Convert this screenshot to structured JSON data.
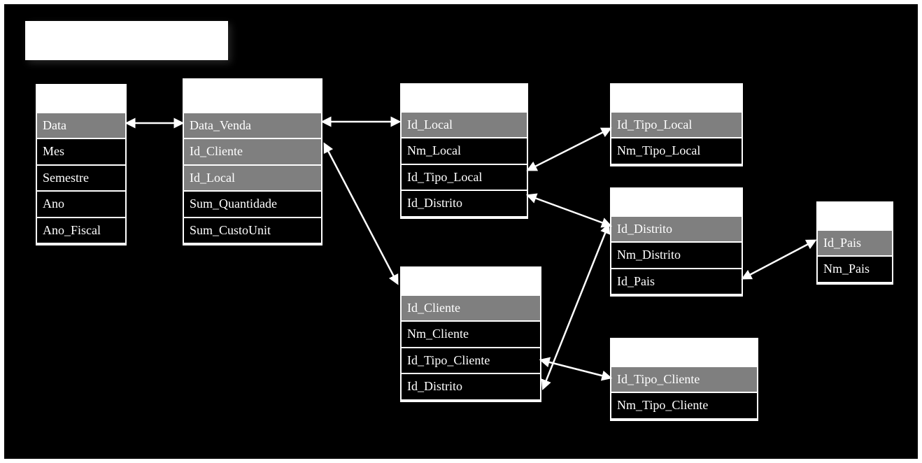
{
  "tables": {
    "calendar": {
      "fields": [
        {
          "name": "Data",
          "key": true
        },
        {
          "name": "Mes",
          "key": false
        },
        {
          "name": "Semestre",
          "key": false
        },
        {
          "name": "Ano",
          "key": false
        },
        {
          "name": "Ano_Fiscal",
          "key": false
        }
      ]
    },
    "fact": {
      "fields": [
        {
          "name": "Data_Venda",
          "key": true
        },
        {
          "name": "Id_Cliente",
          "key": true
        },
        {
          "name": "Id_Local",
          "key": true
        },
        {
          "name": "Sum_Quantidade",
          "key": false
        },
        {
          "name": "Sum_CustoUnit",
          "key": false
        }
      ]
    },
    "local": {
      "fields": [
        {
          "name": "Id_Local",
          "key": true
        },
        {
          "name": "Nm_Local",
          "key": false
        },
        {
          "name": "Id_Tipo_Local",
          "key": false
        },
        {
          "name": "Id_Distrito",
          "key": false
        }
      ]
    },
    "tipolocal": {
      "fields": [
        {
          "name": "Id_Tipo_Local",
          "key": true
        },
        {
          "name": "Nm_Tipo_Local",
          "key": false
        }
      ]
    },
    "distrito": {
      "fields": [
        {
          "name": "Id_Distrito",
          "key": true
        },
        {
          "name": "Nm_Distrito",
          "key": false
        },
        {
          "name": "Id_Pais",
          "key": false
        }
      ]
    },
    "pais": {
      "fields": [
        {
          "name": "Id_Pais",
          "key": true
        },
        {
          "name": "Nm_Pais",
          "key": false
        }
      ]
    },
    "cliente": {
      "fields": [
        {
          "name": "Id_Cliente",
          "key": true
        },
        {
          "name": "Nm_Cliente",
          "key": false
        },
        {
          "name": "Id_Tipo_Cliente",
          "key": false
        },
        {
          "name": "Id_Distrito",
          "key": false
        }
      ]
    },
    "tipocliente": {
      "fields": [
        {
          "name": "Id_Tipo_Cliente",
          "key": true
        },
        {
          "name": "Nm_Tipo_Cliente",
          "key": false
        }
      ]
    }
  }
}
